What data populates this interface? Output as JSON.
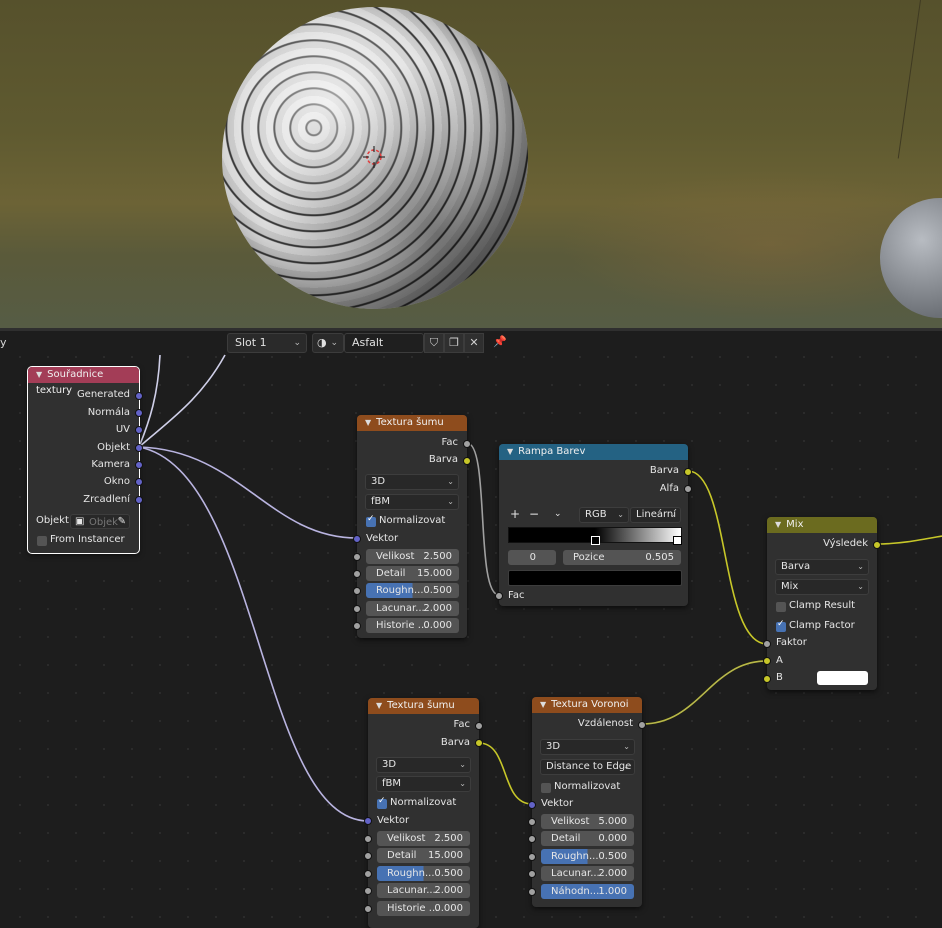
{
  "header": {
    "left_text": "y",
    "slot": "Slot 1",
    "material": "Asfalt"
  },
  "nodes": {
    "tex_coord": {
      "title": "Souřadnice textury",
      "outputs": [
        "Generated",
        "Normála",
        "UV",
        "Objekt",
        "Kamera",
        "Okno",
        "Zrcadlení"
      ],
      "object_label": "Objekt:",
      "object_placeholder": "Objek",
      "from_instancer": "From Instancer",
      "from_instancer_checked": false,
      "color": "#a33d57"
    },
    "noise1": {
      "title": "Textura šumu",
      "outputs": [
        "Fac",
        "Barva"
      ],
      "dimension": "3D",
      "type": "fBM",
      "normalize_label": "Normalizovat",
      "normalize_checked": true,
      "vector_label": "Vektor",
      "fields": [
        {
          "label": "Velikost",
          "value": "2.500"
        },
        {
          "label": "Detail",
          "value": "15.000"
        },
        {
          "label": "Roughn...",
          "value": "0.500",
          "fill": 0.5
        },
        {
          "label": "Lacunar...",
          "value": "2.000"
        },
        {
          "label": "Historie ...",
          "value": "0.000"
        }
      ],
      "color": "#8e4c1d"
    },
    "ramp": {
      "title": "Rampa Barev",
      "outputs": [
        "Barva",
        "Alfa"
      ],
      "add": "+",
      "remove": "−",
      "color_mode": "RGB",
      "interpolation": "Lineární",
      "index": "0",
      "position_label": "Pozice",
      "position_value": "0.505",
      "input": "Fac",
      "color": "#246283"
    },
    "mix": {
      "title": "Mix",
      "output": "Výsledek",
      "data_type": "Barva",
      "blend": "Mix",
      "clamp_result": "Clamp Result",
      "clamp_result_checked": false,
      "clamp_factor": "Clamp Factor",
      "clamp_factor_checked": true,
      "inputs": [
        "Faktor",
        "A",
        "B"
      ],
      "color": "#6b6b1f"
    },
    "noise2": {
      "title": "Textura šumu",
      "outputs": [
        "Fac",
        "Barva"
      ],
      "dimension": "3D",
      "type": "fBM",
      "normalize_label": "Normalizovat",
      "normalize_checked": true,
      "vector_label": "Vektor",
      "fields": [
        {
          "label": "Velikost",
          "value": "2.500"
        },
        {
          "label": "Detail",
          "value": "15.000"
        },
        {
          "label": "Roughn...",
          "value": "0.500",
          "fill": 0.5
        },
        {
          "label": "Lacunar...",
          "value": "2.000"
        },
        {
          "label": "Historie ...",
          "value": "0.000"
        }
      ],
      "color": "#8e4c1d"
    },
    "voronoi": {
      "title": "Textura Voronoi",
      "output": "Vzdálenost",
      "dimension": "3D",
      "feature": "Distance to Edge",
      "normalize_label": "Normalizovat",
      "normalize_checked": false,
      "vector_label": "Vektor",
      "fields": [
        {
          "label": "Velikost",
          "value": "5.000"
        },
        {
          "label": "Detail",
          "value": "0.000"
        },
        {
          "label": "Roughn...",
          "value": "0.500",
          "fill": 0.5
        },
        {
          "label": "Lacunar...",
          "value": "2.000"
        },
        {
          "label": "Náhodn...",
          "value": "1.000",
          "fill": 1.0
        }
      ],
      "color": "#8e4c1d"
    }
  }
}
